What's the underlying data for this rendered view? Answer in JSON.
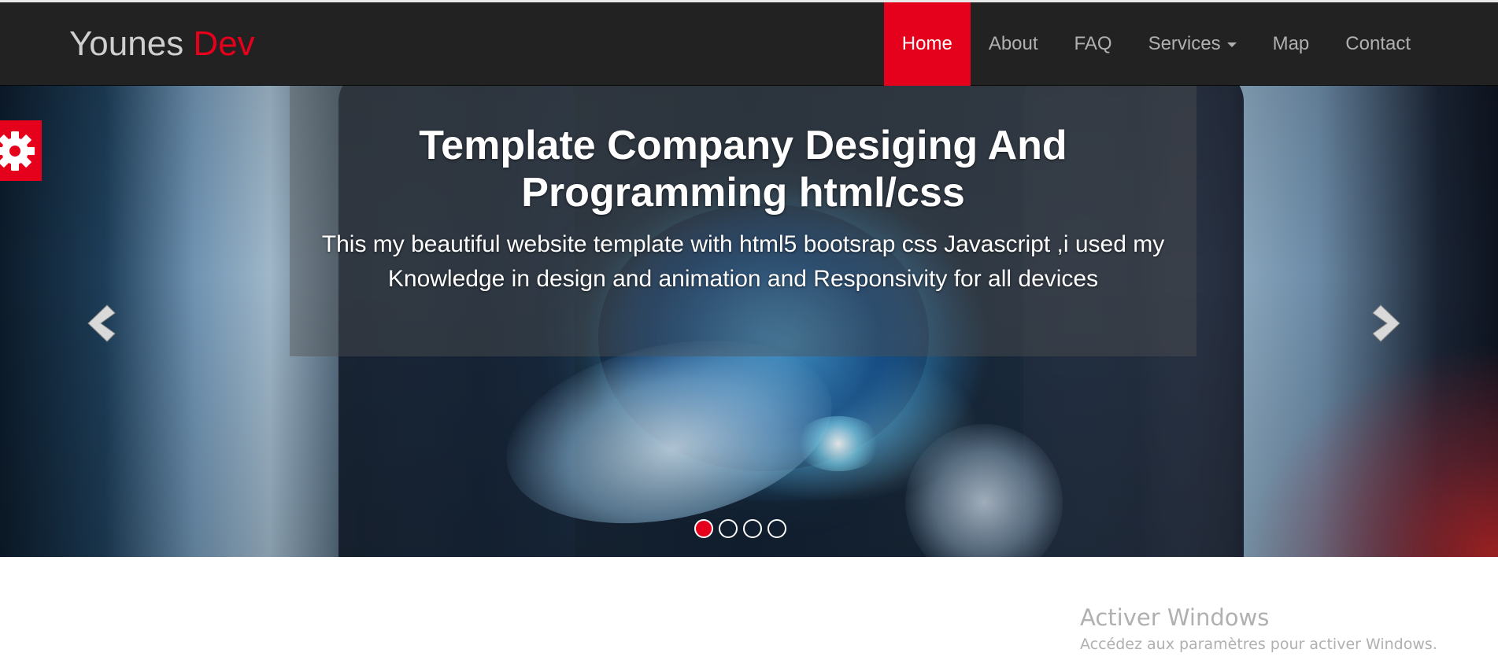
{
  "navbar": {
    "brand_main": "Younes ",
    "brand_accent": "Dev",
    "items": [
      {
        "label": "Home",
        "active": true
      },
      {
        "label": "About",
        "active": false
      },
      {
        "label": "FAQ",
        "active": false
      },
      {
        "label": "Services",
        "active": false,
        "dropdown": true
      },
      {
        "label": "Map",
        "active": false
      },
      {
        "label": "Contact",
        "active": false
      }
    ]
  },
  "hero": {
    "title": "Template Company Desiging And Programming html/css",
    "text": "This my beautiful website template with html5 bootsrap css Javascript ,i used my Knowledge in design and animation and Responsivity for all devices",
    "slide_count": 4,
    "active_slide": 1
  },
  "icons": {
    "prev": "chevron-left-icon",
    "next": "chevron-right-icon",
    "settings": "gear-icon",
    "dropdown": "caret-down-icon"
  },
  "colors": {
    "accent": "#e5001c",
    "navbar_bg": "#222222",
    "nav_text": "#b0b0b0"
  },
  "watermark": {
    "title": "Activer Windows",
    "subtitle": "Accédez aux paramètres pour activer Windows."
  }
}
